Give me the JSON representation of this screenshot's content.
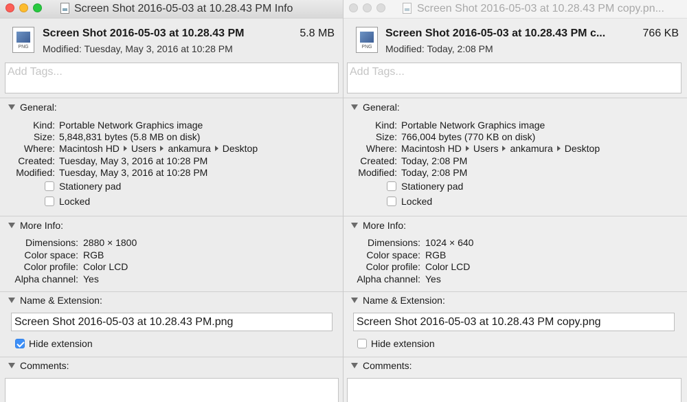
{
  "windows": [
    {
      "title": "Screen Shot 2016-05-03 at 10.28.43 PM Info",
      "file_name": "Screen Shot 2016-05-03 at 10.28.43 PM",
      "file_size": "5.8 MB",
      "modified_line": "Modified: Tuesday, May 3, 2016 at 10:28 PM",
      "icon_badge": "PNG",
      "tags_placeholder": "Add Tags...",
      "general": {
        "header": "General:",
        "kind_label": "Kind:",
        "kind": "Portable Network Graphics image",
        "size_label": "Size:",
        "size": "5,848,831 bytes (5.8 MB on disk)",
        "where_label": "Where:",
        "where": [
          "Macintosh HD",
          "Users",
          "ankamura",
          "Desktop"
        ],
        "created_label": "Created:",
        "created": "Tuesday, May 3, 2016 at 10:28 PM",
        "modified_label": "Modified:",
        "modified": "Tuesday, May 3, 2016 at 10:28 PM",
        "stationery_label": "Stationery pad",
        "stationery_checked": false,
        "locked_label": "Locked",
        "locked_checked": false
      },
      "more_info": {
        "header": "More Info:",
        "dimensions_label": "Dimensions:",
        "dimensions": "2880 × 1800",
        "colorspace_label": "Color space:",
        "colorspace": "RGB",
        "profile_label": "Color profile:",
        "profile": "Color LCD",
        "alpha_label": "Alpha channel:",
        "alpha": "Yes"
      },
      "name_ext": {
        "header": "Name & Extension:",
        "filename": "Screen Shot 2016-05-03 at 10.28.43 PM.png",
        "hide_ext_label": "Hide extension",
        "hide_ext_checked": true
      },
      "comments": {
        "header": "Comments:"
      }
    },
    {
      "title": "Screen Shot 2016-05-03 at 10.28.43 PM copy.pn...",
      "file_name": "Screen Shot 2016-05-03 at 10.28.43 PM c...",
      "file_size": "766 KB",
      "modified_line": "Modified: Today, 2:08 PM",
      "icon_badge": "PNG",
      "tags_placeholder": "Add Tags...",
      "general": {
        "header": "General:",
        "kind_label": "Kind:",
        "kind": "Portable Network Graphics image",
        "size_label": "Size:",
        "size": "766,004 bytes (770 KB on disk)",
        "where_label": "Where:",
        "where": [
          "Macintosh HD",
          "Users",
          "ankamura",
          "Desktop"
        ],
        "created_label": "Created:",
        "created": "Today, 2:08 PM",
        "modified_label": "Modified:",
        "modified": "Today, 2:08 PM",
        "stationery_label": "Stationery pad",
        "stationery_checked": false,
        "locked_label": "Locked",
        "locked_checked": false
      },
      "more_info": {
        "header": "More Info:",
        "dimensions_label": "Dimensions:",
        "dimensions": "1024 × 640",
        "colorspace_label": "Color space:",
        "colorspace": "RGB",
        "profile_label": "Color profile:",
        "profile": "Color LCD",
        "alpha_label": "Alpha channel:",
        "alpha": "Yes"
      },
      "name_ext": {
        "header": "Name & Extension:",
        "filename": "Screen Shot 2016-05-03 at 10.28.43 PM copy.png",
        "hide_ext_label": "Hide extension",
        "hide_ext_checked": false
      },
      "comments": {
        "header": "Comments:"
      }
    }
  ]
}
